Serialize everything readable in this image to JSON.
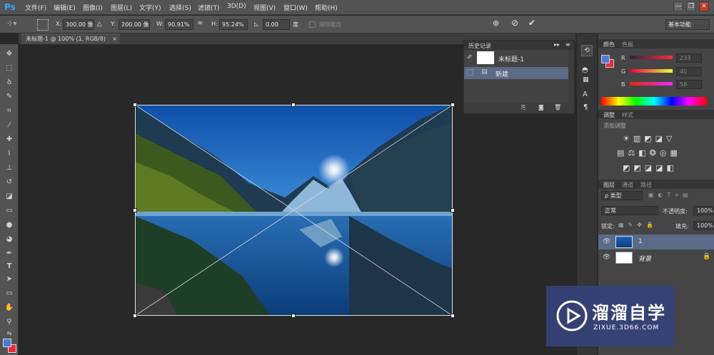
{
  "app": {
    "logo": "Ps"
  },
  "menu": [
    "文件(F)",
    "编辑(E)",
    "图像(I)",
    "图层(L)",
    "文字(Y)",
    "选择(S)",
    "滤镜(T)",
    "3D(D)",
    "视图(V)",
    "窗口(W)",
    "帮助(H)"
  ],
  "window_controls": {
    "minimize": "—",
    "restore": "❐",
    "close": "✕"
  },
  "options": {
    "x_label": "X:",
    "x_value": "300.00 像",
    "y_label": "Y:",
    "y_value": "200.00 像",
    "w_label": "W:",
    "w_value": "90.91%",
    "h_label": "H:",
    "h_value": "95.24%",
    "angle_value": "0.00",
    "angle_unit": "度",
    "interp_label": "消除锯齿",
    "workspace": "基本功能"
  },
  "document": {
    "tab_title": "未标题-1 @ 100% (1, RGB/8)",
    "tab_close": "×"
  },
  "history": {
    "tab_label": "历史记录",
    "snapshot_label": "未标题-1",
    "steps": [
      {
        "label": "新建"
      }
    ]
  },
  "color_panel": {
    "tabs": [
      "颜色",
      "色板"
    ],
    "r_label": "R",
    "r_value": "233",
    "g_label": "G",
    "g_value": "40",
    "b_label": "B",
    "b_value": "58",
    "foreground": "#4d7bd6",
    "background": "#e9283a"
  },
  "adjustments": {
    "tabs": [
      "调整",
      "样式"
    ],
    "add_label": "添加调整"
  },
  "layers": {
    "tabs": [
      "图层",
      "通道",
      "路径"
    ],
    "filter_label": "ρ 类型",
    "blend_mode": "正常",
    "opacity_label": "不透明度:",
    "opacity_value": "100%",
    "lock_label": "锁定:",
    "fill_label": "填充:",
    "fill_value": "100%",
    "items": [
      {
        "name": "1",
        "selected": true
      },
      {
        "name": "背景",
        "selected": false
      }
    ]
  },
  "watermark": {
    "title": "溜溜自学",
    "url": "ZIXUE.3D66.COM"
  },
  "colors": {
    "accent": "#31a8ff",
    "selected_layer": "#5b6a86",
    "panel": "#454545"
  }
}
